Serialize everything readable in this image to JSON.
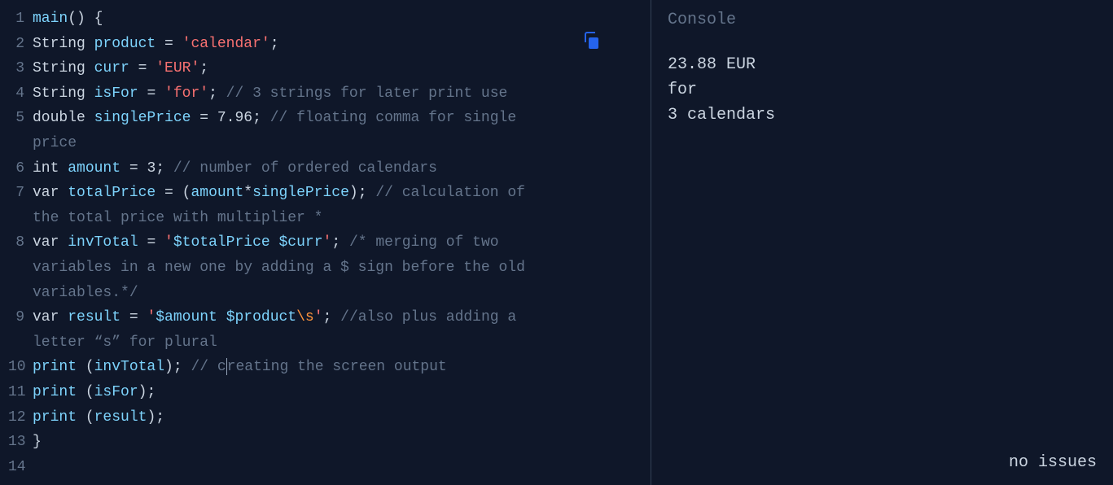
{
  "editor": {
    "lines": [
      {
        "n": "1",
        "tokens": [
          [
            "main",
            "func"
          ],
          [
            "() {",
            "punc"
          ]
        ]
      },
      {
        "n": "2",
        "tokens": [
          [
            "String ",
            "type"
          ],
          [
            "product",
            "ident"
          ],
          [
            " = ",
            "op"
          ],
          [
            "'calendar'",
            "str"
          ],
          [
            ";",
            "punc"
          ]
        ]
      },
      {
        "n": "3",
        "tokens": [
          [
            "String ",
            "type"
          ],
          [
            "curr",
            "ident"
          ],
          [
            " = ",
            "op"
          ],
          [
            "'EUR'",
            "str"
          ],
          [
            ";",
            "punc"
          ]
        ]
      },
      {
        "n": "4",
        "tokens": [
          [
            "String ",
            "type"
          ],
          [
            "isFor",
            "ident"
          ],
          [
            " = ",
            "op"
          ],
          [
            "'for'",
            "str"
          ],
          [
            "; ",
            "punc"
          ],
          [
            "// 3 strings for later print use",
            "comment"
          ]
        ]
      },
      {
        "n": "5",
        "tokens": [
          [
            "double ",
            "type"
          ],
          [
            "singlePrice",
            "ident"
          ],
          [
            " = ",
            "op"
          ],
          [
            "7.96",
            "num"
          ],
          [
            "; ",
            "punc"
          ],
          [
            "// floating comma for single",
            "comment"
          ]
        ]
      },
      {
        "n": "",
        "wrap": true,
        "tokens": [
          [
            "price",
            "comment"
          ]
        ]
      },
      {
        "n": "6",
        "tokens": [
          [
            "int ",
            "type"
          ],
          [
            "amount",
            "ident"
          ],
          [
            " = ",
            "op"
          ],
          [
            "3",
            "num"
          ],
          [
            "; ",
            "punc"
          ],
          [
            "// number of ordered calendars",
            "comment"
          ]
        ]
      },
      {
        "n": "7",
        "tokens": [
          [
            "var ",
            "keyword"
          ],
          [
            "totalPrice",
            "ident"
          ],
          [
            " = (",
            "op"
          ],
          [
            "amount",
            "ident"
          ],
          [
            "*",
            "op"
          ],
          [
            "singlePrice",
            "ident"
          ],
          [
            "); ",
            "punc"
          ],
          [
            "// calculation of",
            "comment"
          ]
        ]
      },
      {
        "n": "",
        "wrap": true,
        "tokens": [
          [
            "the total price with multiplier *",
            "comment"
          ]
        ]
      },
      {
        "n": "8",
        "tokens": [
          [
            "var ",
            "keyword"
          ],
          [
            "invTotal",
            "ident"
          ],
          [
            " = ",
            "op"
          ],
          [
            "'",
            "str"
          ],
          [
            "$totalPrice",
            "var"
          ],
          [
            " ",
            "str"
          ],
          [
            "$curr",
            "var"
          ],
          [
            "'",
            "str"
          ],
          [
            "; ",
            "punc"
          ],
          [
            "/* merging of two",
            "comment"
          ]
        ]
      },
      {
        "n": "",
        "wrap": true,
        "tokens": [
          [
            "variables in a new one by adding a $ sign before the old",
            "comment"
          ]
        ]
      },
      {
        "n": "",
        "wrap": true,
        "tokens": [
          [
            "variables.*/",
            "comment"
          ]
        ]
      },
      {
        "n": "9",
        "tokens": [
          [
            "var ",
            "keyword"
          ],
          [
            "result",
            "ident"
          ],
          [
            " = ",
            "op"
          ],
          [
            "'",
            "str"
          ],
          [
            "$amount",
            "var"
          ],
          [
            " ",
            "str"
          ],
          [
            "$product",
            "var"
          ],
          [
            "\\s",
            "esc"
          ],
          [
            "'",
            "str"
          ],
          [
            "; ",
            "punc"
          ],
          [
            "//also plus adding a",
            "comment"
          ]
        ]
      },
      {
        "n": "",
        "wrap": true,
        "tokens": [
          [
            "letter “s” for plural",
            "comment"
          ]
        ]
      },
      {
        "n": "10",
        "tokens": [
          [
            "print ",
            "func"
          ],
          [
            "(",
            "punc"
          ],
          [
            "invTotal",
            "ident"
          ],
          [
            "); ",
            "punc"
          ],
          [
            "// c",
            "comment"
          ],
          [
            "",
            "cursor"
          ],
          [
            "reating the screen output",
            "comment"
          ]
        ]
      },
      {
        "n": "11",
        "tokens": [
          [
            "print ",
            "func"
          ],
          [
            "(",
            "punc"
          ],
          [
            "isFor",
            "ident"
          ],
          [
            ");",
            "punc"
          ]
        ]
      },
      {
        "n": "12",
        "tokens": [
          [
            "print ",
            "func"
          ],
          [
            "(",
            "punc"
          ],
          [
            "result",
            "ident"
          ],
          [
            ");",
            "punc"
          ]
        ]
      },
      {
        "n": "13",
        "tokens": [
          [
            "}",
            "punc"
          ]
        ]
      },
      {
        "n": "14",
        "tokens": [
          [
            "",
            "punc"
          ]
        ]
      }
    ]
  },
  "copy_icon": "copy-icon",
  "console": {
    "title": "Console",
    "output": [
      "23.88 EUR",
      "for",
      "3 calendars"
    ],
    "status": "no issues"
  }
}
